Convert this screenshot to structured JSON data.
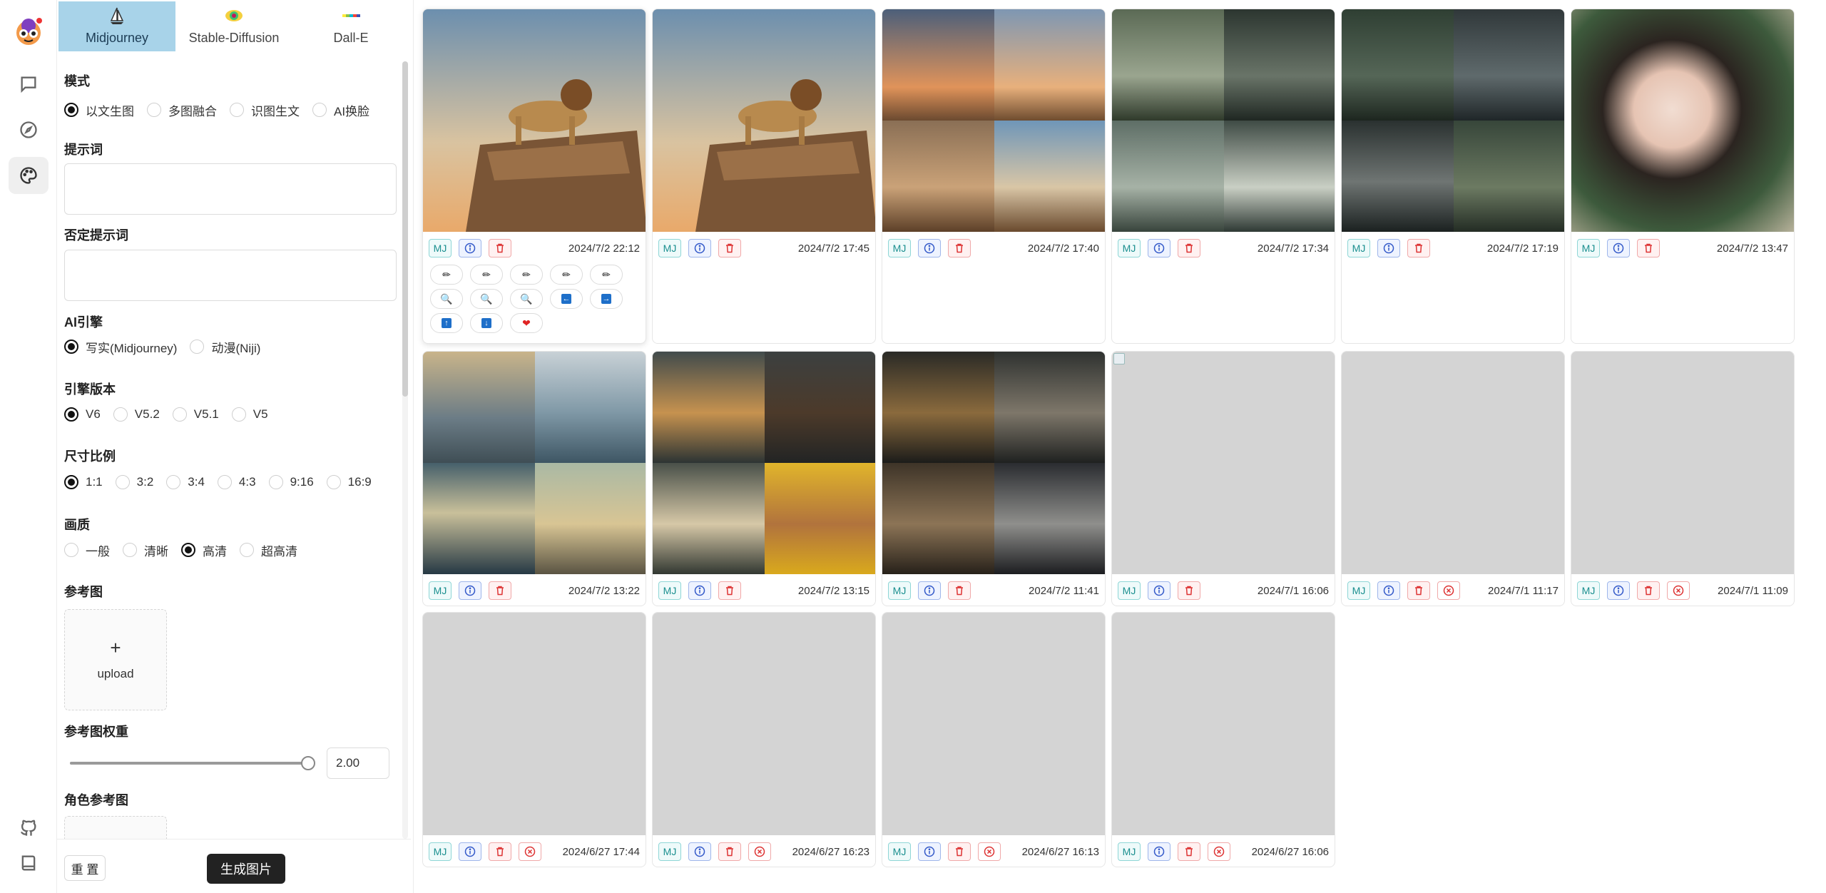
{
  "tabs": [
    {
      "label": "Midjourney",
      "active": true
    },
    {
      "label": "Stable-Diffusion",
      "active": false
    },
    {
      "label": "Dall-E",
      "active": false
    }
  ],
  "form": {
    "mode_title": "模式",
    "mode_options": [
      "以文生图",
      "多图融合",
      "识图生文",
      "AI换脸"
    ],
    "mode_selected": "以文生图",
    "prompt_title": "提示词",
    "prompt_value": "",
    "negative_title": "否定提示词",
    "negative_value": "",
    "engine_title": "AI引擎",
    "engine_options": [
      "写实(Midjourney)",
      "动漫(Niji)"
    ],
    "engine_selected": "写实(Midjourney)",
    "version_title": "引擎版本",
    "version_options": [
      "V6",
      "V5.2",
      "V5.1",
      "V5"
    ],
    "version_selected": "V6",
    "ratio_title": "尺寸比例",
    "ratio_options": [
      "1:1",
      "3:2",
      "3:4",
      "4:3",
      "9:16",
      "16:9"
    ],
    "ratio_selected": "1:1",
    "quality_title": "画质",
    "quality_options": [
      "一般",
      "清晰",
      "高清",
      "超高清"
    ],
    "quality_selected": "高清",
    "ref_title": "参考图",
    "upload_plus": "+",
    "upload_label": "upload",
    "weight_title": "参考图权重",
    "weight_value": "2.00",
    "weight_fraction": 1.0,
    "role_title": "角色参考图"
  },
  "footer": {
    "reset_label": "重 置",
    "generate_label": "生成图片"
  },
  "gallery": [
    {
      "time": "2024/7/2 22:12",
      "theme": "lion",
      "status": "done",
      "expanded": true
    },
    {
      "time": "2024/7/2 17:45",
      "theme": "lion",
      "status": "done"
    },
    {
      "time": "2024/7/2 17:40",
      "theme": "lion-grid",
      "status": "done"
    },
    {
      "time": "2024/7/2 17:34",
      "theme": "deer-grid",
      "status": "done"
    },
    {
      "time": "2024/7/2 17:19",
      "theme": "wolf-grid",
      "status": "done"
    },
    {
      "time": "2024/7/2 13:47",
      "theme": "portrait",
      "status": "done"
    },
    {
      "time": "2024/7/2 13:22",
      "theme": "boat-grid",
      "status": "done"
    },
    {
      "time": "2024/7/2 13:15",
      "theme": "dog-grid",
      "status": "done"
    },
    {
      "time": "2024/7/2 11:41",
      "theme": "cat-grid",
      "status": "done"
    },
    {
      "time": "2024/7/1 16:06",
      "theme": "broken",
      "status": "done"
    },
    {
      "time": "2024/7/1 11:17",
      "theme": "blank",
      "status": "failed"
    },
    {
      "time": "2024/7/1 11:09",
      "theme": "blank",
      "status": "failed"
    },
    {
      "time": "2024/6/27 17:44",
      "theme": "blank",
      "status": "failed"
    },
    {
      "time": "2024/6/27 16:23",
      "theme": "blank",
      "status": "failed"
    },
    {
      "time": "2024/6/27 16:13",
      "theme": "blank",
      "status": "failed"
    },
    {
      "time": "2024/6/27 16:06",
      "theme": "blank",
      "status": "failed"
    }
  ],
  "badge_label": "MJ",
  "action_icons": [
    "pencil-icon",
    "pencil-icon",
    "pencil-icon",
    "pencil-icon",
    "pencil-icon",
    "magnifier-icon",
    "magnifier-icon",
    "magnifier-icon",
    "arrow-left-icon",
    "arrow-right-icon",
    "arrow-up-icon",
    "arrow-down-icon",
    "heart-icon"
  ]
}
